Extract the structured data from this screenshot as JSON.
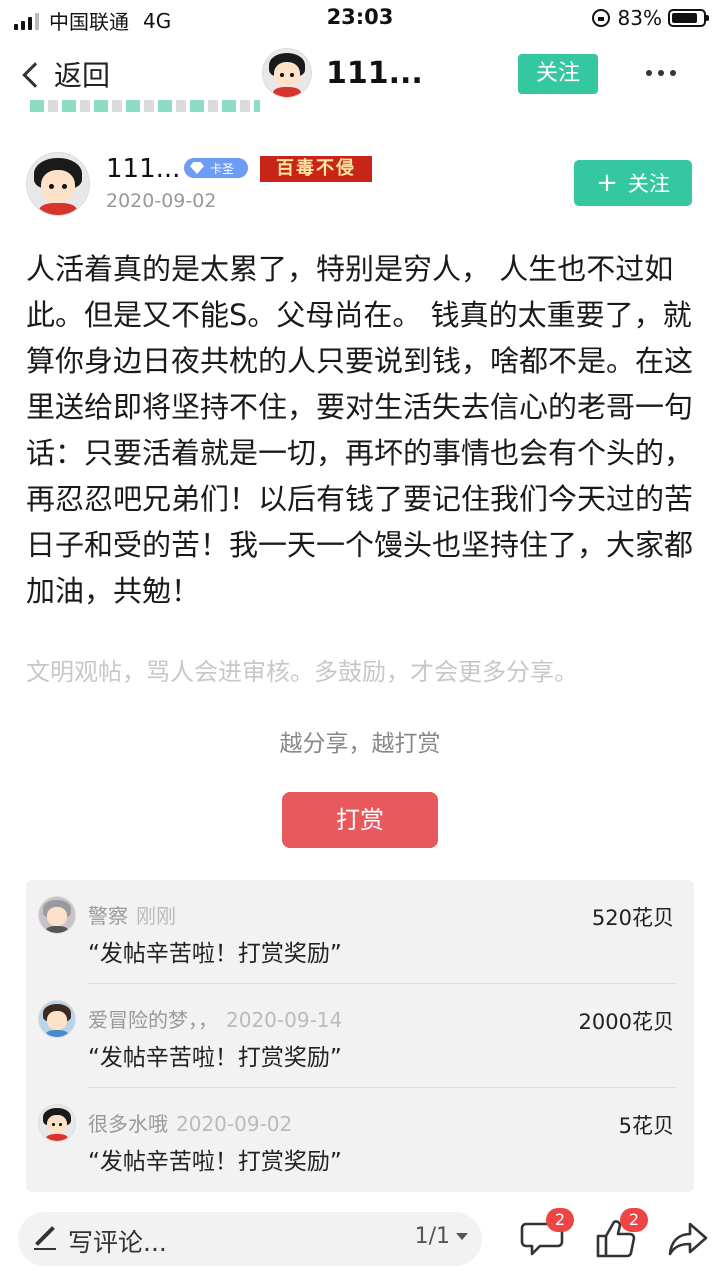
{
  "status_bar": {
    "carrier": "中国联通",
    "network": "4G",
    "time": "23:03",
    "battery": "83%",
    "battery_level": 0.83
  },
  "nav": {
    "back_label": "返回",
    "title": "111...",
    "follow_label": "关注"
  },
  "author": {
    "name": "111...",
    "badge_level": "卡圣",
    "badge_title": "百毒不侵",
    "date": "2020-09-02",
    "follow_label": "关注"
  },
  "post": {
    "content": "人活着真的是太累了，特别是穷人， 人生也不过如此。但是又不能S。父母尚在。 钱真的太重要了，就算你身边日夜共枕的人只要说到钱，啥都不是。在这里送给即将坚持不住，要对生活失去信心的老哥一句话：只要活着就是一切，再坏的事情也会有个头的，再忍忍吧兄弟们！以后有钱了要记住我们今天过的苦日子和受的苦！我一天一个馒头也坚持住了，大家都加油，共勉！",
    "notice": "文明观帖，骂人会进审核。多鼓励，才会更多分享。",
    "slogan": "越分享，越打赏",
    "tip_button": "打赏"
  },
  "tips": [
    {
      "user": "警察",
      "time": "刚刚",
      "message": "“发帖辛苦啦！打赏奖励”",
      "amount": "520花贝"
    },
    {
      "user": "爱冒险的梦，，",
      "time": "2020-09-14",
      "message": "“发帖辛苦啦！打赏奖励”",
      "amount": "2000花贝"
    },
    {
      "user": "很多水哦",
      "time": "2020-09-02",
      "message": "“发帖辛苦啦！打赏奖励”",
      "amount": "5花贝"
    }
  ],
  "bottom_bar": {
    "comment_placeholder": "写评论...",
    "page_indicator": "1/1",
    "comment_count": "2",
    "like_count": "2"
  },
  "colors": {
    "accent_green": "#34c7a0",
    "tip_red": "#e8585d",
    "badge_red": "#ee4444"
  }
}
